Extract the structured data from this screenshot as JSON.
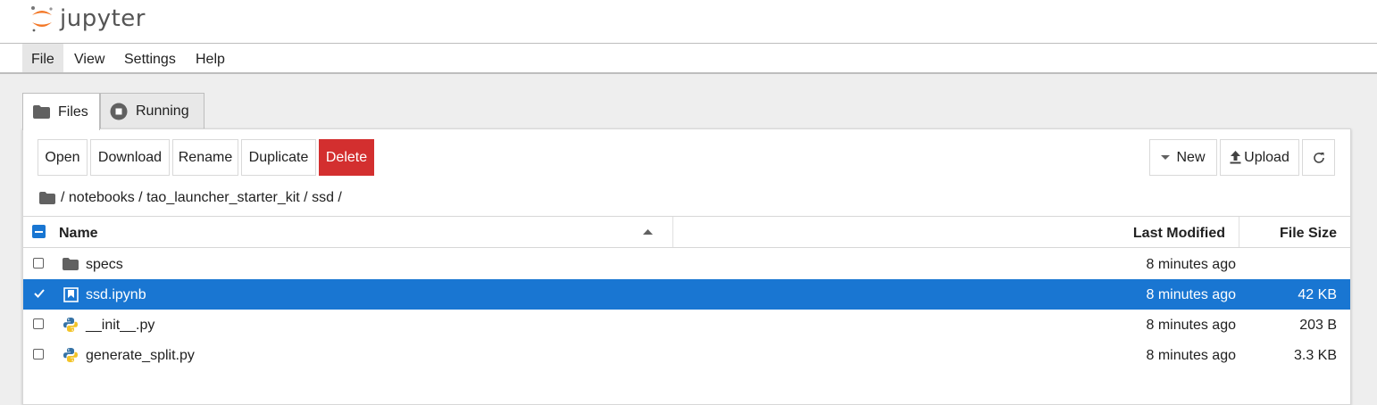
{
  "header": {
    "logo_text": "jupyter"
  },
  "menu": {
    "items": [
      "File",
      "View",
      "Settings",
      "Help"
    ],
    "active": "File"
  },
  "tabs": [
    {
      "label": "Files",
      "icon": "folder-icon",
      "active": true
    },
    {
      "label": "Running",
      "icon": "stop-circle-icon",
      "active": false
    }
  ],
  "toolbar": {
    "open": "Open",
    "download": "Download",
    "rename": "Rename",
    "duplicate": "Duplicate",
    "delete": "Delete",
    "new": "New",
    "upload": "Upload"
  },
  "breadcrumb": {
    "parts": [
      "notebooks",
      "tao_launcher_starter_kit",
      "ssd"
    ]
  },
  "listing": {
    "headers": {
      "name": "Name",
      "modified": "Last Modified",
      "size": "File Size"
    },
    "rows": [
      {
        "name": "specs",
        "type": "folder",
        "modified": "8 minutes ago",
        "size": "",
        "selected": false
      },
      {
        "name": "ssd.ipynb",
        "type": "notebook",
        "modified": "8 minutes ago",
        "size": "42 KB",
        "selected": true
      },
      {
        "name": "__init__.py",
        "type": "python",
        "modified": "8 minutes ago",
        "size": "203 B",
        "selected": false
      },
      {
        "name": "generate_split.py",
        "type": "python",
        "modified": "8 minutes ago",
        "size": "3.3 KB",
        "selected": false
      }
    ]
  },
  "colors": {
    "accent": "#1976d2",
    "danger": "#d32f2f",
    "logo_orange": "#f37726"
  }
}
